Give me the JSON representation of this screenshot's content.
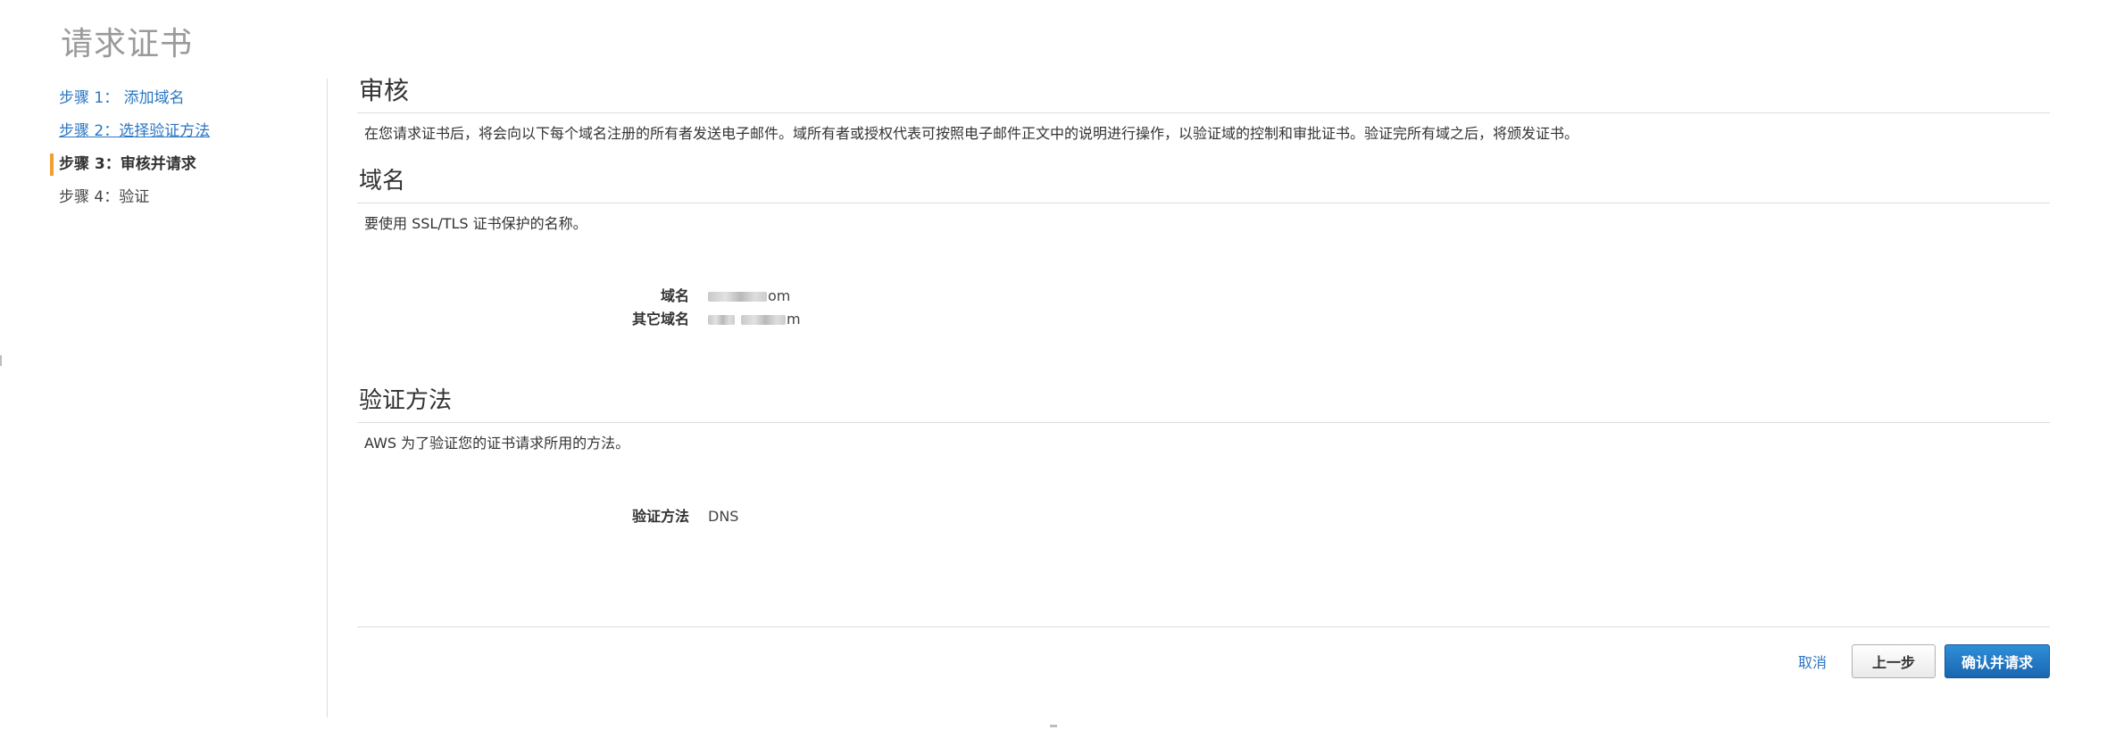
{
  "page": {
    "title": "请求证书"
  },
  "steps": [
    {
      "label": "步骤 1： 添加域名",
      "state": "link"
    },
    {
      "label": "步骤 2：选择验证方法",
      "state": "link"
    },
    {
      "label": "步骤 3：审核并请求",
      "state": "active"
    },
    {
      "label": "步骤 4：验证",
      "state": "plain"
    }
  ],
  "review": {
    "heading": "审核",
    "description": "在您请求证书后，将会向以下每个域名注册的所有者发送电子邮件。域所有者或授权代表可按照电子邮件正文中的说明进行操作，以验证域的控制和审批证书。验证完所有域之后，将颁发证书。"
  },
  "domains": {
    "heading": "域名",
    "description": "要使用 SSL/TLS 证书保护的名称。",
    "domain_label": "域名",
    "domain_value_suffix": "om",
    "other_label": "其它域名",
    "other_value_suffix": "m"
  },
  "validation": {
    "heading": "验证方法",
    "description": "AWS 为了验证您的证书请求所用的方法。",
    "method_label": "验证方法",
    "method_value": "DNS"
  },
  "actions": {
    "cancel": "取消",
    "previous": "上一步",
    "confirm": "确认并请求"
  },
  "colors": {
    "link": "#2a76c2",
    "active_marker": "#f0a030",
    "primary_button": "#1a66b0"
  }
}
